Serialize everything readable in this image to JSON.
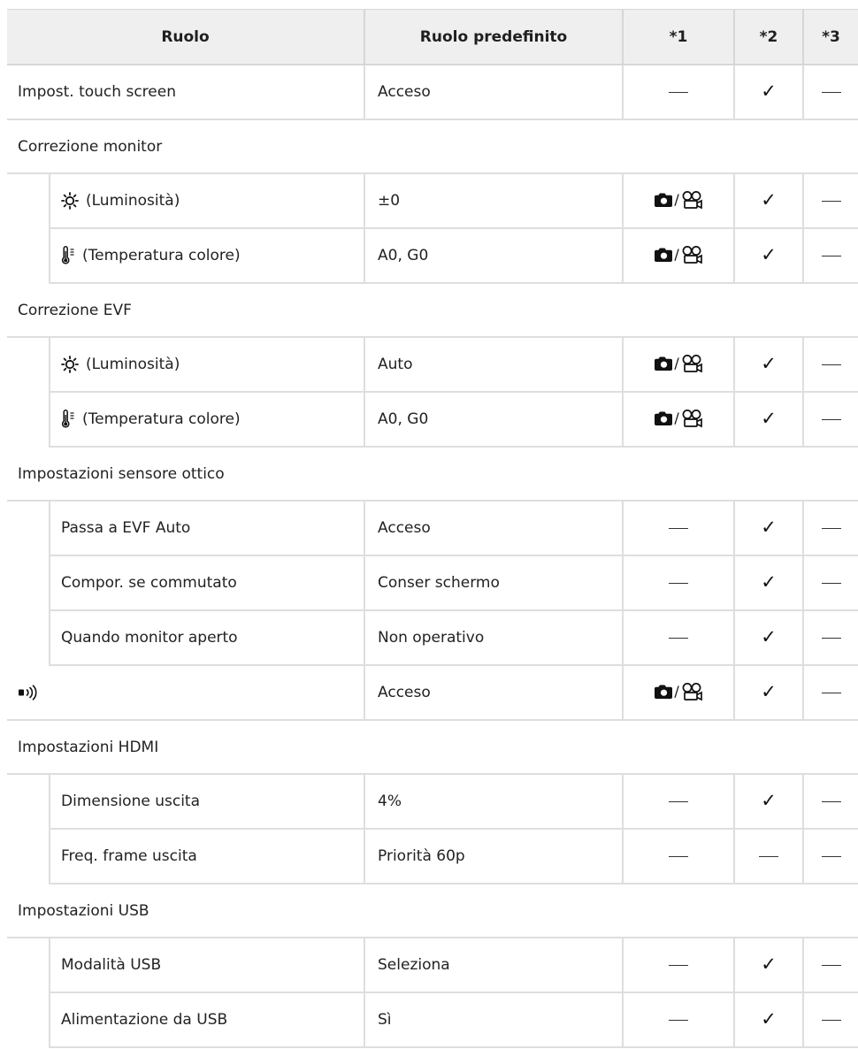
{
  "headers": {
    "setting": "Ruolo",
    "default": "Ruolo predefinito",
    "c1": "*1",
    "c2": "*2",
    "c3": "*3"
  },
  "rows": [
    {
      "type": "row",
      "name": "Impost. touch screen",
      "default": "Acceso",
      "c1": "—",
      "c2": "✓",
      "c3": "—"
    },
    {
      "type": "group",
      "label": "Correzione monitor"
    },
    {
      "type": "sub",
      "icon": "sun-brightness-icon",
      "name": "(Luminosità)",
      "default": "±0",
      "c1": "camera/movie",
      "c2": "✓",
      "c3": "—"
    },
    {
      "type": "sub",
      "icon": "thermometer-icon",
      "name": "(Temperatura colore)",
      "default": "A0, G0",
      "c1": "camera/movie",
      "c2": "✓",
      "c3": "—"
    },
    {
      "type": "group",
      "label": "Correzione EVF"
    },
    {
      "type": "sub",
      "icon": "sun-brightness-icon",
      "name": "(Luminosità)",
      "default": "Auto",
      "c1": "camera/movie",
      "c2": "✓",
      "c3": "—"
    },
    {
      "type": "sub",
      "icon": "thermometer-icon",
      "name": "(Temperatura colore)",
      "default": "A0, G0",
      "c1": "camera/movie",
      "c2": "✓",
      "c3": "—"
    },
    {
      "type": "group",
      "label": "Impostazioni sensore ottico"
    },
    {
      "type": "sub",
      "name": "Passa a EVF Auto",
      "default": "Acceso",
      "c1": "—",
      "c2": "✓",
      "c3": "—"
    },
    {
      "type": "sub",
      "name": "Compor. se commutato",
      "default": "Conser schermo",
      "c1": "—",
      "c2": "✓",
      "c3": "—"
    },
    {
      "type": "sub",
      "name": "Quando monitor aperto",
      "default": "Non operativo",
      "c1": "—",
      "c2": "✓",
      "c3": "—"
    },
    {
      "type": "row",
      "icon": "beep-sound-icon",
      "name": "",
      "default": "Acceso",
      "c1": "camera/movie",
      "c2": "✓",
      "c3": "—"
    },
    {
      "type": "group",
      "label": "Impostazioni HDMI"
    },
    {
      "type": "sub",
      "name": "Dimensione uscita",
      "default": "4%",
      "c1": "—",
      "c2": "✓",
      "c3": "—"
    },
    {
      "type": "sub",
      "name": "Freq. frame uscita",
      "default": "Priorità 60p",
      "c1": "—",
      "c2": "—",
      "c3": "—"
    },
    {
      "type": "group",
      "label": "Impostazioni USB"
    },
    {
      "type": "sub",
      "name": "Modalità USB",
      "default": "Seleziona",
      "c1": "—",
      "c2": "✓",
      "c3": "—"
    },
    {
      "type": "sub",
      "name": "Alimentazione da USB",
      "default": "Sì",
      "c1": "—",
      "c2": "✓",
      "c3": "—"
    }
  ]
}
